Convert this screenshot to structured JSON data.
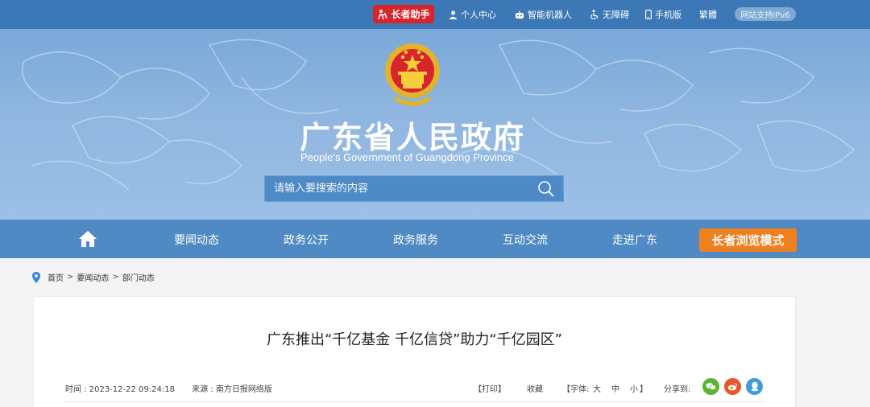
{
  "topbar": {
    "elder_helper": "长者助手",
    "personal_center": "个人中心",
    "smart_robot": "智能机器人",
    "accessibility": "无障碍",
    "mobile": "手机版",
    "traditional": "繁體",
    "ipv6": "网站支持IPv6"
  },
  "header": {
    "title": "广东省人民政府",
    "subtitle": "People's Government of Guangdong Province"
  },
  "search": {
    "placeholder": "请输入要搜索的内容"
  },
  "nav": {
    "items": [
      "要闻动态",
      "政务公开",
      "政务服务",
      "互动交流",
      "走进广东"
    ],
    "elder_mode": "长者浏览模式"
  },
  "breadcrumb": {
    "items": [
      "首页",
      "要闻动态",
      "部门动态"
    ],
    "separator": ">"
  },
  "article": {
    "title": "广东推出“千亿基金 千亿信贷”助力“千亿园区”",
    "time": "时间 : 2023-12-22 09:24:18",
    "source": "来源 : 南方日报网络版"
  },
  "tools": {
    "print": "【打印】",
    "favorite": "收藏",
    "font_open": "【字体:",
    "font_large": "大",
    "font_medium": "中",
    "font_small": "小",
    "font_close": "】",
    "share": "分享到:"
  },
  "colors": {
    "topbar": "#3c78b6",
    "nav": "#4f8ac4",
    "elder_helper": "#d8252b",
    "elder_mode": "#f07f1d",
    "wechat": "#5cb531",
    "weibo": "#e8562a",
    "qq": "#3f9bdc"
  }
}
